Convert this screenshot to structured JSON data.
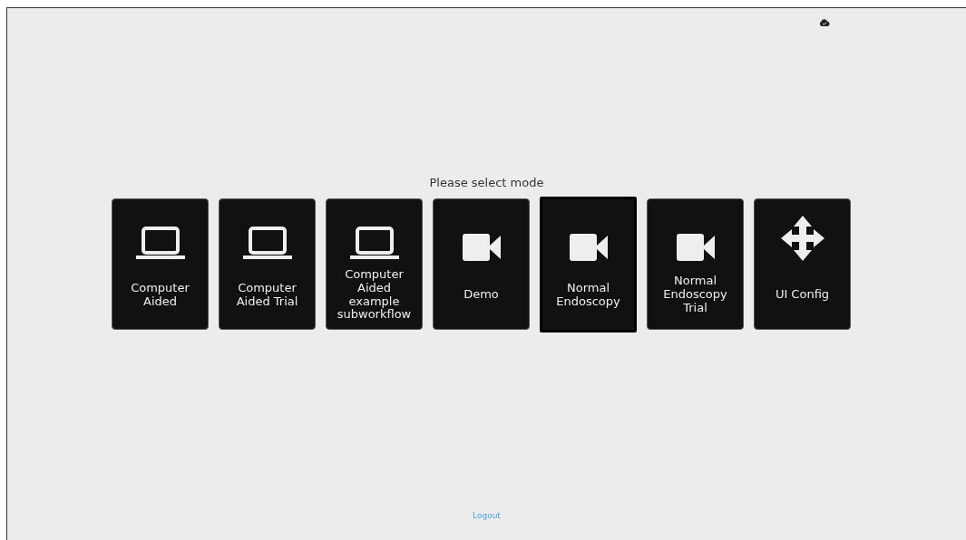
{
  "heading": "Please select mode",
  "modes": [
    {
      "label": "Computer Aided",
      "kind": "laptop",
      "selected": false
    },
    {
      "label": "Computer Aided Trial",
      "kind": "laptop",
      "selected": false
    },
    {
      "label": "Computer Aided example subworkflow",
      "kind": "laptop",
      "selected": false
    },
    {
      "label": "Demo",
      "kind": "camera",
      "selected": false
    },
    {
      "label": "Normal Endoscopy",
      "kind": "camera",
      "selected": true
    },
    {
      "label": "Normal Endoscopy Trial",
      "kind": "camera",
      "selected": false
    },
    {
      "label": "UI Config",
      "kind": "move",
      "selected": false
    }
  ],
  "logout": "Logout"
}
